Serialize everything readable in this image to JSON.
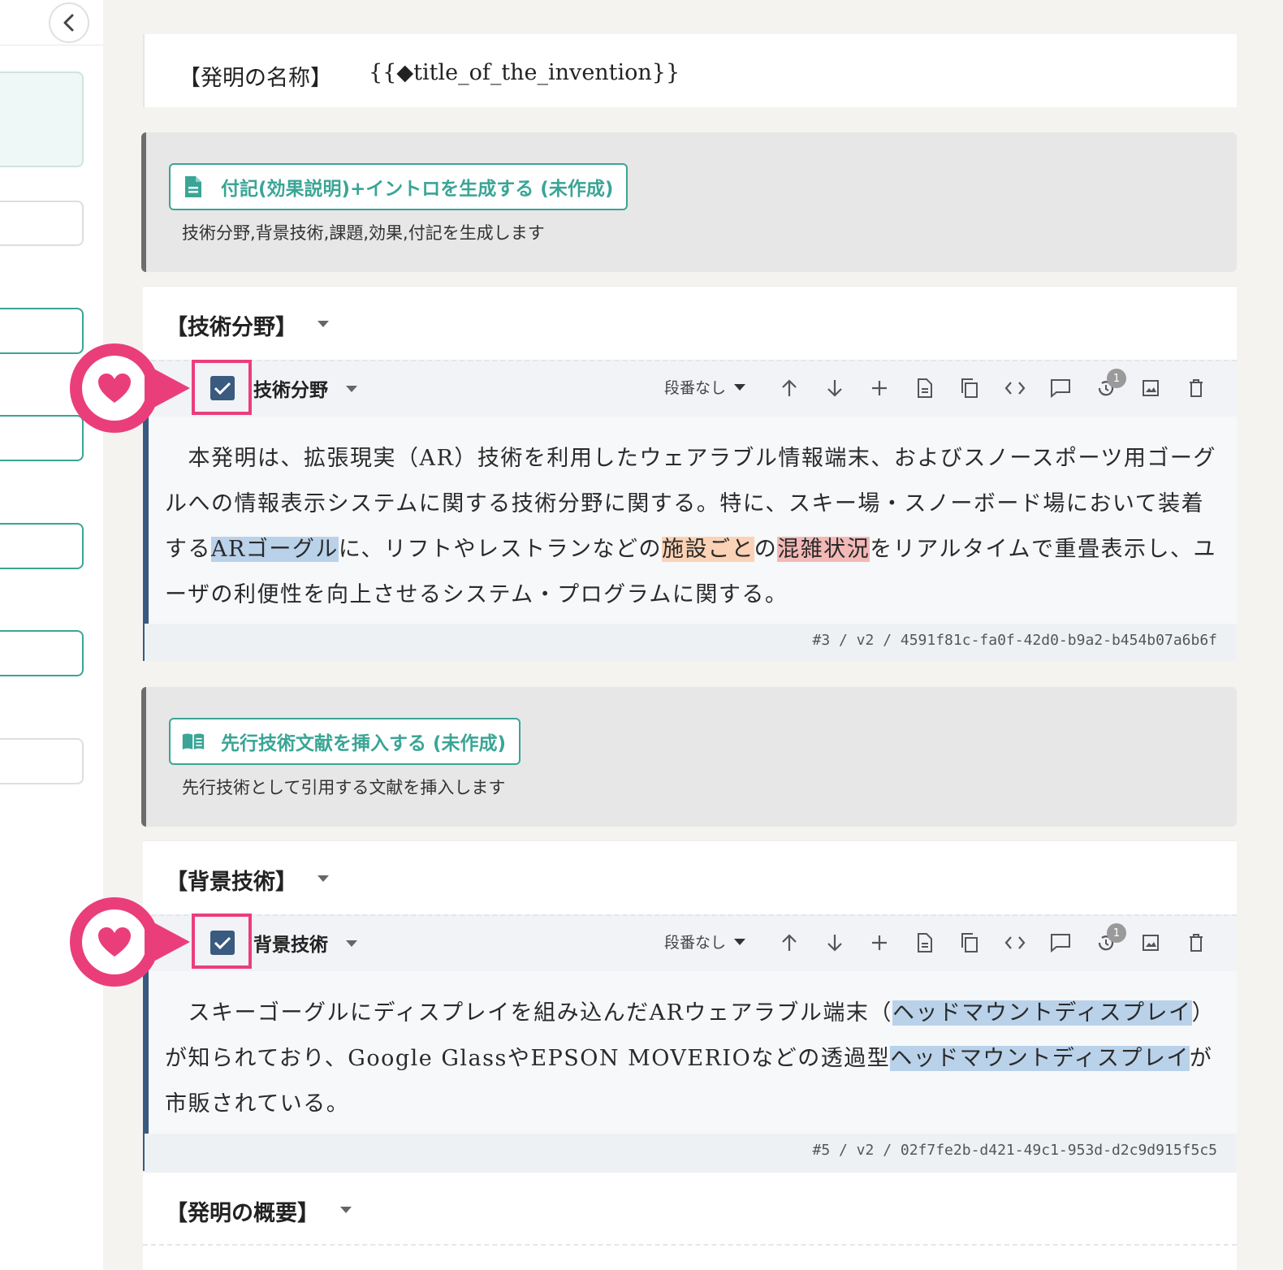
{
  "sidebar": {
    "collapse_icon": "chevron-left-icon"
  },
  "document": {
    "title_label": "【発明の名称】",
    "title_value": "{{◆title_of_the_invention}}"
  },
  "generators": [
    {
      "button": "付記(効果説明)+イントロを生成する (未作成)",
      "icon": "document-icon",
      "description": "技術分野,背景技術,課題,効果,付記を生成します"
    },
    {
      "button": "先行技術文献を挿入する (未作成)",
      "icon": "book-icon",
      "description": "先行技術として引用する文献を挿入します"
    }
  ],
  "sections": [
    {
      "title": "【技術分野】",
      "paragraph": {
        "name": "技術分野",
        "checked": true,
        "numbering": "段番なし",
        "history_count": "1",
        "text": [
          {
            "t": "　本発明は、拡張現実（AR）技術を利用したウェアラブル情報端末、およびスノースポーツ用ゴーグルへの情報表示システムに関する技術分野に関する。特に、スキー場・スノーボード場において装着する"
          },
          {
            "t": "ARゴーグル",
            "hl": "blue"
          },
          {
            "t": "に、リフトやレストランなどの"
          },
          {
            "t": "施設ごと",
            "hl": "orange"
          },
          {
            "t": "の"
          },
          {
            "t": "混雑状況",
            "hl": "red"
          },
          {
            "t": "をリアルタイムで重畳表示し、ユーザの利便性を向上させるシステム・プログラムに関する。"
          }
        ],
        "id": "#3 / v2 / 4591f81c-fa0f-42d0-b9a2-b454b07a6b6f"
      }
    },
    {
      "title": "【背景技術】",
      "paragraph": {
        "name": "背景技術",
        "checked": true,
        "numbering": "段番なし",
        "history_count": "1",
        "text": [
          {
            "t": "　スキーゴーグルにディスプレイを組み込んだARウェアラブル端末（"
          },
          {
            "t": "ヘッドマウントディスプレイ",
            "hl": "blue"
          },
          {
            "t": "）が知られており、Google GlassやEPSON MOVERIOなどの透過型"
          },
          {
            "t": "ヘッドマウントディスプレイ",
            "hl": "blue"
          },
          {
            "t": "が市販されている。"
          }
        ],
        "id": "#5 / v2 / 02f7fe2b-d421-49c1-953d-d2c9d915f5c5"
      }
    },
    {
      "title": "【発明の概要】"
    }
  ],
  "toolbar_icons": [
    "arrow-up-icon",
    "arrow-down-icon",
    "plus-icon",
    "document-icon",
    "copy-icon",
    "code-icon",
    "comment-icon",
    "history-icon",
    "image-icon",
    "trash-icon"
  ],
  "colors": {
    "accent": "#3aa596",
    "paragraph_bar": "#385a80",
    "checkbox": "#3b5a7f",
    "marker": "#ea3e7a",
    "highlight_blue": "#b9d2ea",
    "highlight_orange": "#fbd2b5",
    "highlight_red": "#f3b9b7"
  }
}
